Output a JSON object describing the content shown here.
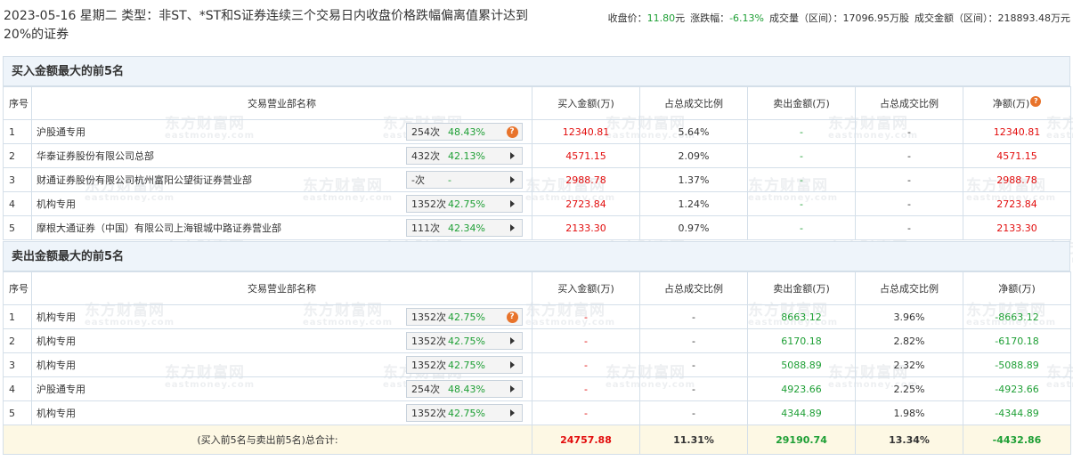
{
  "header": {
    "title": "2023-05-16 星期二 类型：非ST、*ST和S证券连续三个交易日内收盘价格跌幅偏离值累计达到20%的证券",
    "close_label": "收盘价：",
    "close_value": "11.80",
    "close_unit": "元",
    "change_label": "涨跌幅：",
    "change_value": "-6.13%",
    "volume_label": "成交量（区间）：",
    "volume_value": "17096.95万股",
    "amount_label": "成交金额（区间）：",
    "amount_value": "218893.48万元"
  },
  "watermark": {
    "cn": "东方财富网",
    "en": "eastmoney.com"
  },
  "columns": [
    "序号",
    "交易营业部名称",
    "买入金额(万)",
    "占总成交比例",
    "卖出金额(万)",
    "占总成交比例",
    "净额(万)"
  ],
  "buy_section": {
    "title": "买入金额最大的前5名",
    "rows": [
      {
        "seq": "1",
        "name": "沪股通专用",
        "times": "254次",
        "pct": "48.43%",
        "icon": "question-icon",
        "buy": "12340.81",
        "buy_ratio": "5.64%",
        "sell": "-",
        "sell_ratio": "-",
        "net": "12340.81"
      },
      {
        "seq": "2",
        "name": "华泰证券股份有限公司总部",
        "times": "432次",
        "pct": "42.13%",
        "icon": "arrow-right-icon",
        "buy": "4571.15",
        "buy_ratio": "2.09%",
        "sell": "-",
        "sell_ratio": "-",
        "net": "4571.15"
      },
      {
        "seq": "3",
        "name": "财通证券股份有限公司杭州富阳公望街证券营业部",
        "times": "-次",
        "pct": "-",
        "icon": "arrow-right-icon",
        "buy": "2988.78",
        "buy_ratio": "1.37%",
        "sell": "-",
        "sell_ratio": "-",
        "net": "2988.78"
      },
      {
        "seq": "4",
        "name": "机构专用",
        "times": "1352次",
        "pct": "42.75%",
        "icon": "arrow-right-icon",
        "buy": "2723.84",
        "buy_ratio": "1.24%",
        "sell": "-",
        "sell_ratio": "-",
        "net": "2723.84"
      },
      {
        "seq": "5",
        "name": "摩根大通证券（中国）有限公司上海银城中路证券营业部",
        "times": "111次",
        "pct": "42.34%",
        "icon": "arrow-right-icon",
        "buy": "2133.30",
        "buy_ratio": "0.97%",
        "sell": "-",
        "sell_ratio": "-",
        "net": "2133.30"
      }
    ]
  },
  "sell_section": {
    "title": "卖出金额最大的前5名",
    "rows": [
      {
        "seq": "1",
        "name": "机构专用",
        "times": "1352次",
        "pct": "42.75%",
        "icon": "question-icon",
        "buy": "-",
        "buy_ratio": "-",
        "sell": "8663.12",
        "sell_ratio": "3.96%",
        "net": "-8663.12"
      },
      {
        "seq": "2",
        "name": "机构专用",
        "times": "1352次",
        "pct": "42.75%",
        "icon": "arrow-right-icon",
        "buy": "-",
        "buy_ratio": "-",
        "sell": "6170.18",
        "sell_ratio": "2.82%",
        "net": "-6170.18"
      },
      {
        "seq": "3",
        "name": "机构专用",
        "times": "1352次",
        "pct": "42.75%",
        "icon": "arrow-right-icon",
        "buy": "-",
        "buy_ratio": "-",
        "sell": "5088.89",
        "sell_ratio": "2.32%",
        "net": "-5088.89"
      },
      {
        "seq": "4",
        "name": "沪股通专用",
        "times": "254次",
        "pct": "48.43%",
        "icon": "arrow-right-icon",
        "buy": "-",
        "buy_ratio": "-",
        "sell": "4923.66",
        "sell_ratio": "2.25%",
        "net": "-4923.66"
      },
      {
        "seq": "5",
        "name": "机构专用",
        "times": "1352次",
        "pct": "42.75%",
        "icon": "arrow-right-icon",
        "buy": "-",
        "buy_ratio": "-",
        "sell": "4344.89",
        "sell_ratio": "1.98%",
        "net": "-4344.89"
      }
    ]
  },
  "total": {
    "label": "(买入前5名与卖出前5名)总合计:",
    "buy": "24757.88",
    "buy_ratio": "11.31%",
    "sell": "29190.74",
    "sell_ratio": "13.34%",
    "net": "-4432.86"
  },
  "colors": {
    "up": "#e20c0c",
    "down": "#1e9f35",
    "section_bg": "#eef4fa",
    "total_bg": "#fdf8e4",
    "accent_icon": "#e8732b"
  }
}
